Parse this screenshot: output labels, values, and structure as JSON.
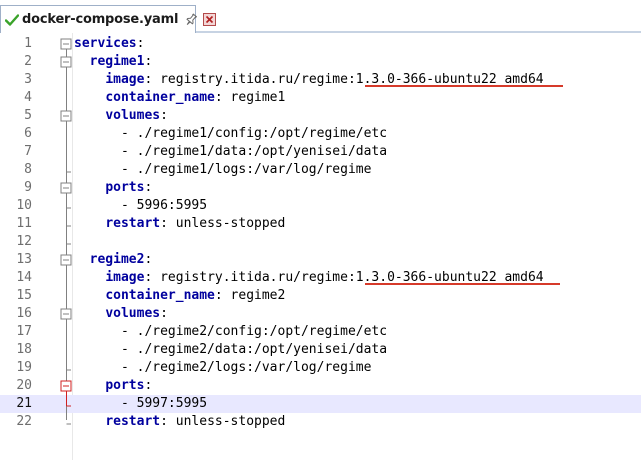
{
  "tab": {
    "title": "docker-compose.yaml",
    "icon": "saved-check-icon",
    "pin_icon": "pin-icon",
    "close_icon": "close-icon"
  },
  "colors": {
    "key": "#00009e",
    "highlight_underline": "#d63a2a",
    "current_line": "#e8e8ff",
    "fold_marker": "#808080",
    "fold_marker_active": "#d02020"
  },
  "editor": {
    "current_line": 21,
    "lines": [
      {
        "n": "1",
        "indent": "",
        "key": "services",
        "sep": ":",
        "value": ""
      },
      {
        "n": "2",
        "indent": "  ",
        "key": "regime1",
        "sep": ":",
        "value": ""
      },
      {
        "n": "3",
        "indent": "    ",
        "key": "image",
        "sep": ":",
        "value": " registry.itida.ru/regime:1.3.0-366-ubuntu22_amd64"
      },
      {
        "n": "4",
        "indent": "    ",
        "key": "container_name",
        "sep": ":",
        "value": " regime1"
      },
      {
        "n": "5",
        "indent": "    ",
        "key": "volumes",
        "sep": ":",
        "value": ""
      },
      {
        "n": "6",
        "indent": "      ",
        "key": "",
        "sep": "",
        "value": "- ./regime1/config:/opt/regime/etc"
      },
      {
        "n": "7",
        "indent": "      ",
        "key": "",
        "sep": "",
        "value": "- ./regime1/data:/opt/yenisei/data"
      },
      {
        "n": "8",
        "indent": "      ",
        "key": "",
        "sep": "",
        "value": "- ./regime1/logs:/var/log/regime"
      },
      {
        "n": "9",
        "indent": "    ",
        "key": "ports",
        "sep": ":",
        "value": ""
      },
      {
        "n": "10",
        "indent": "      ",
        "key": "",
        "sep": "",
        "value": "- 5996:5995"
      },
      {
        "n": "11",
        "indent": "    ",
        "key": "restart",
        "sep": ":",
        "value": " unless-stopped"
      },
      {
        "n": "12",
        "indent": "",
        "key": "",
        "sep": "",
        "value": ""
      },
      {
        "n": "13",
        "indent": "  ",
        "key": "regime2",
        "sep": ":",
        "value": ""
      },
      {
        "n": "14",
        "indent": "    ",
        "key": "image",
        "sep": ":",
        "value": " registry.itida.ru/regime:1.3.0-366-ubuntu22_amd64"
      },
      {
        "n": "15",
        "indent": "    ",
        "key": "container_name",
        "sep": ":",
        "value": " regime2"
      },
      {
        "n": "16",
        "indent": "    ",
        "key": "volumes",
        "sep": ":",
        "value": ""
      },
      {
        "n": "17",
        "indent": "      ",
        "key": "",
        "sep": "",
        "value": "- ./regime2/config:/opt/regime/etc"
      },
      {
        "n": "18",
        "indent": "      ",
        "key": "",
        "sep": "",
        "value": "- ./regime2/data:/opt/yenisei/data"
      },
      {
        "n": "19",
        "indent": "      ",
        "key": "",
        "sep": "",
        "value": "- ./regime2/logs:/var/log/regime"
      },
      {
        "n": "20",
        "indent": "    ",
        "key": "ports",
        "sep": ":",
        "value": ""
      },
      {
        "n": "21",
        "indent": "      ",
        "key": "",
        "sep": "",
        "value": "- 5997:5995"
      },
      {
        "n": "22",
        "indent": "    ",
        "key": "restart",
        "sep": ":",
        "value": " unless-stopped"
      }
    ]
  }
}
